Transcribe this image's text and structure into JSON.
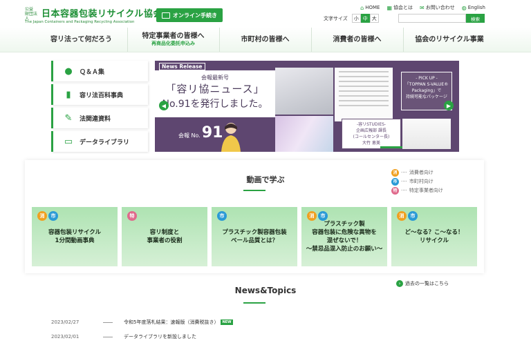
{
  "header": {
    "logo_small": "公益\n財団法人",
    "logo_name": "日本容器包装リサイクル協会",
    "logo_en": "The Japan Containers and Packaging Recycling Association",
    "online_button": "オンライン手続き",
    "top_links": [
      {
        "icon": "home-icon",
        "label": "HOME"
      },
      {
        "icon": "building-icon",
        "label": "協会とは"
      },
      {
        "icon": "mail-icon",
        "label": "お問い合わせ"
      },
      {
        "icon": "globe-icon",
        "label": "English"
      }
    ],
    "font_size_label": "文字サイズ",
    "font_sizes": [
      "小",
      "中",
      "大"
    ],
    "search_placeholder": "",
    "search_button": "検索"
  },
  "gnav": [
    {
      "label": "容リ法って何だろう",
      "sub": ""
    },
    {
      "label": "特定事業者の皆様へ",
      "sub": "再商品化委託申込み"
    },
    {
      "label": "市町村の皆様へ",
      "sub": ""
    },
    {
      "label": "消費者の皆様へ",
      "sub": ""
    },
    {
      "label": "協会のリサイクル事業",
      "sub": ""
    }
  ],
  "side_menu": [
    {
      "icon": "chat-icon",
      "label": "Ｑ＆Ａ集"
    },
    {
      "icon": "book-icon",
      "label": "容リ法百科事典"
    },
    {
      "icon": "edit-icon",
      "label": "法関連資料"
    },
    {
      "icon": "box-icon",
      "label": "データライブラリ"
    }
  ],
  "hero": {
    "tag": "News Release",
    "line1": "会報最新号",
    "line2": "「容リ協ニュース」",
    "line3": "No.91を発行しました。",
    "number_prefix": "会報 No.",
    "number": "91",
    "pick_text": "- PICK UP -\n「TOPPAN S-VALUE®\nPackaging」で\n持続可能なパッケージ",
    "studies_text": "-容リSTUDIES-\n企画広報部 課長\n(コールセンター長)\n大竹 恵美"
  },
  "videos": {
    "title": "動画で学ぶ",
    "legend": [
      {
        "badge": "消",
        "color": "#f0a020",
        "label": "消費者向け"
      },
      {
        "badge": "市",
        "color": "#2a9ad6",
        "label": "市町村向け"
      },
      {
        "badge": "特",
        "color": "#e06a8c",
        "label": "特定事業者向け"
      }
    ],
    "items": [
      {
        "badges": [
          "消",
          "市"
        ],
        "label": "容器包装リサイクル\n1分間動画事典"
      },
      {
        "badges": [
          "特"
        ],
        "label": "容リ制度と\n事業者の役割"
      },
      {
        "badges": [
          "市"
        ],
        "label": "プラスチック製容器包装\nベール品質とは？"
      },
      {
        "badges": [
          "消",
          "市"
        ],
        "label": "プラスチック製\n容器包装に危険な異物を\n混ぜないで！\n〜禁忌品混入防止のお願い〜"
      },
      {
        "badges": [
          "消",
          "市"
        ],
        "label": "ど〜なる？こ〜なる！\nリサイクル"
      }
    ]
  },
  "news": {
    "title": "News&Topics",
    "past_link": "過去の一覧はこちら",
    "items": [
      {
        "date": "2023/02/27",
        "text": "令和5年度落札結果：速報版（消費税抜き）",
        "new": "NEW"
      },
      {
        "date": "2023/02/01",
        "text": "データライブラリを新設しました",
        "new": ""
      }
    ]
  }
}
